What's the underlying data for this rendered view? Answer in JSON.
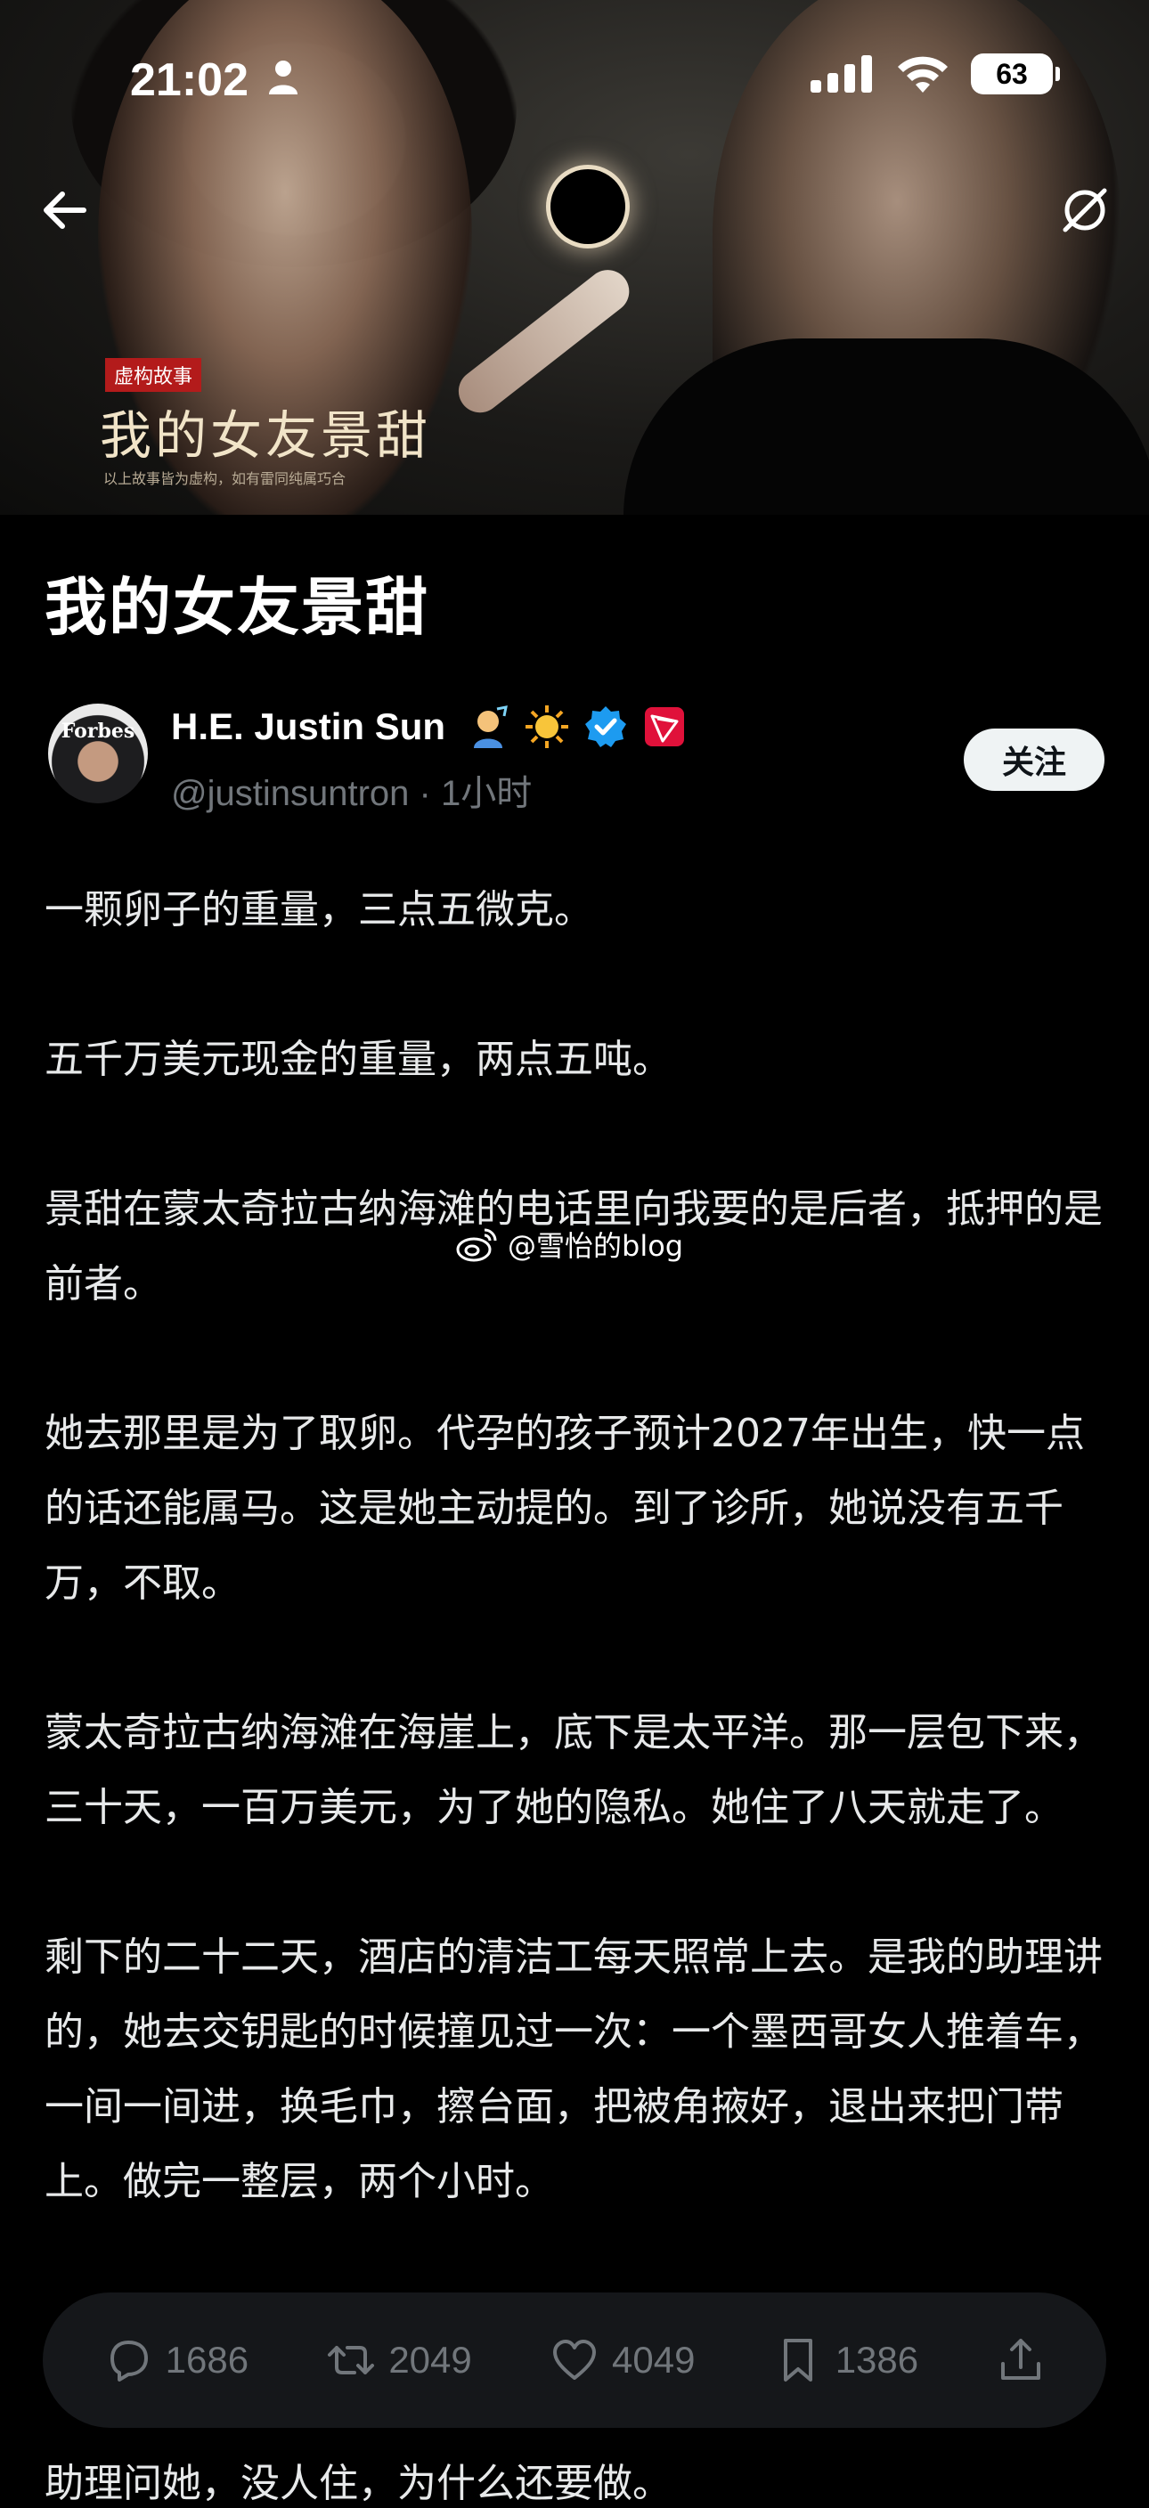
{
  "status_bar": {
    "time": "21:02",
    "battery": "63"
  },
  "hero": {
    "badge": "虚构故事",
    "title": "我的女友景甜",
    "note": "以上故事皆为虚构，如有雷同纯属巧合"
  },
  "post": {
    "title": "我的女友景甜",
    "author": {
      "name": "H.E. Justin Sun",
      "handle": "@justinsuntron",
      "time": "· 1小时",
      "avatar_text": "Forbes"
    },
    "follow_label": "关注",
    "paragraphs": [
      "一颗卵子的重量，三点五微克。",
      "五千万美元现金的重量，两点五吨。",
      "景甜在蒙太奇拉古纳海滩的电话里向我要的是后者，抵押的是前者。",
      "她去那里是为了取卵。代孕的孩子预计2027年出生，快一点的话还能属马。这是她主动提的。到了诊所，她说没有五千万，不取。",
      "蒙太奇拉古纳海滩在海崖上，底下是太平洋。那一层包下来，三十天，一百万美元，为了她的隐私。她住了八天就走了。",
      "剩下的二十二天，酒店的清洁工每天照常上去。是我的助理讲的，她去交钥匙的时候撞见过一次：一个墨西哥女人推着车，一间一间进，换毛巾，擦台面，把被角掖好，退出来把门带上。做完一整层，两个小时。"
    ],
    "trailing_text": "助理问她，没人住，为什么还要做。",
    "watermark": "@雪怡的blog"
  },
  "actions": {
    "replies": "1686",
    "reposts": "2049",
    "likes": "4049",
    "bookmarks": "1386"
  }
}
